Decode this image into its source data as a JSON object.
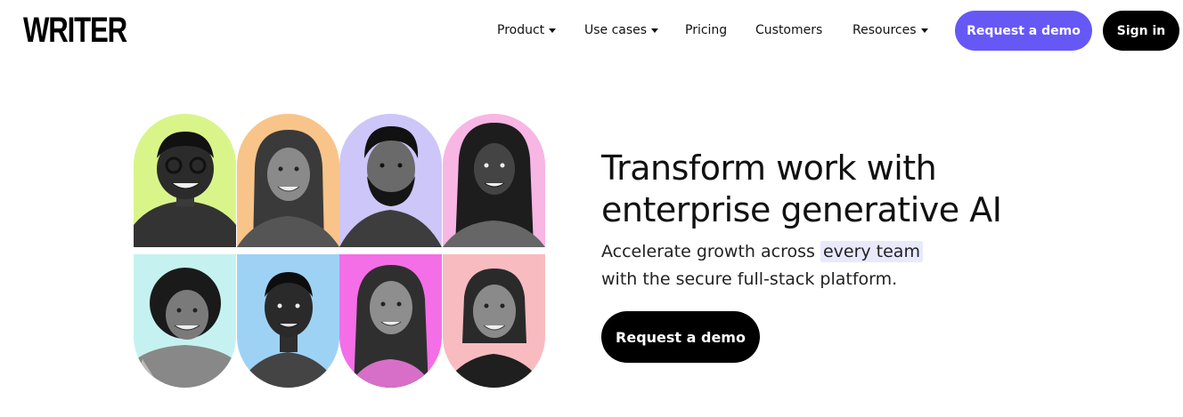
{
  "header": {
    "logo": "WRITER",
    "nav": [
      {
        "label": "Product",
        "dropdown": true
      },
      {
        "label": "Use cases",
        "dropdown": true
      },
      {
        "label": "Pricing",
        "dropdown": false
      },
      {
        "label": "Customers",
        "dropdown": false
      },
      {
        "label": "Resources",
        "dropdown": true
      }
    ],
    "request_demo": "Request a demo",
    "sign_in": "Sign in"
  },
  "hero": {
    "title_line1": "Transform work with",
    "title_line2": "enterprise generative AI",
    "subtitle_before": "Accelerate growth across ",
    "subtitle_highlight": "every team",
    "subtitle_line2": "with the secure full-stack platform.",
    "cta": "Request a demo"
  },
  "colors": {
    "accent": "#6658f5",
    "highlight": "#e8e9fd",
    "portrait_backgrounds": [
      "#d9f58a",
      "#f8c48a",
      "#cdc6f9",
      "#f7b6e4",
      "#c5f2f0",
      "#9ed2f5",
      "#f46ee7",
      "#f8bcc0"
    ]
  },
  "portraits": [
    {
      "name": "portrait-man-glasses",
      "bg": "#d9f58a"
    },
    {
      "name": "portrait-woman-smiling",
      "bg": "#f8c48a"
    },
    {
      "name": "portrait-man-beard",
      "bg": "#cdc6f9"
    },
    {
      "name": "portrait-woman-braids",
      "bg": "#f7b6e4"
    },
    {
      "name": "portrait-woman-curly-hair",
      "bg": "#c5f2f0"
    },
    {
      "name": "portrait-young-man",
      "bg": "#9ed2f5"
    },
    {
      "name": "portrait-woman-long-hair",
      "bg": "#f46ee7"
    },
    {
      "name": "portrait-man-shoulder-hair",
      "bg": "#f8bcc0"
    }
  ]
}
